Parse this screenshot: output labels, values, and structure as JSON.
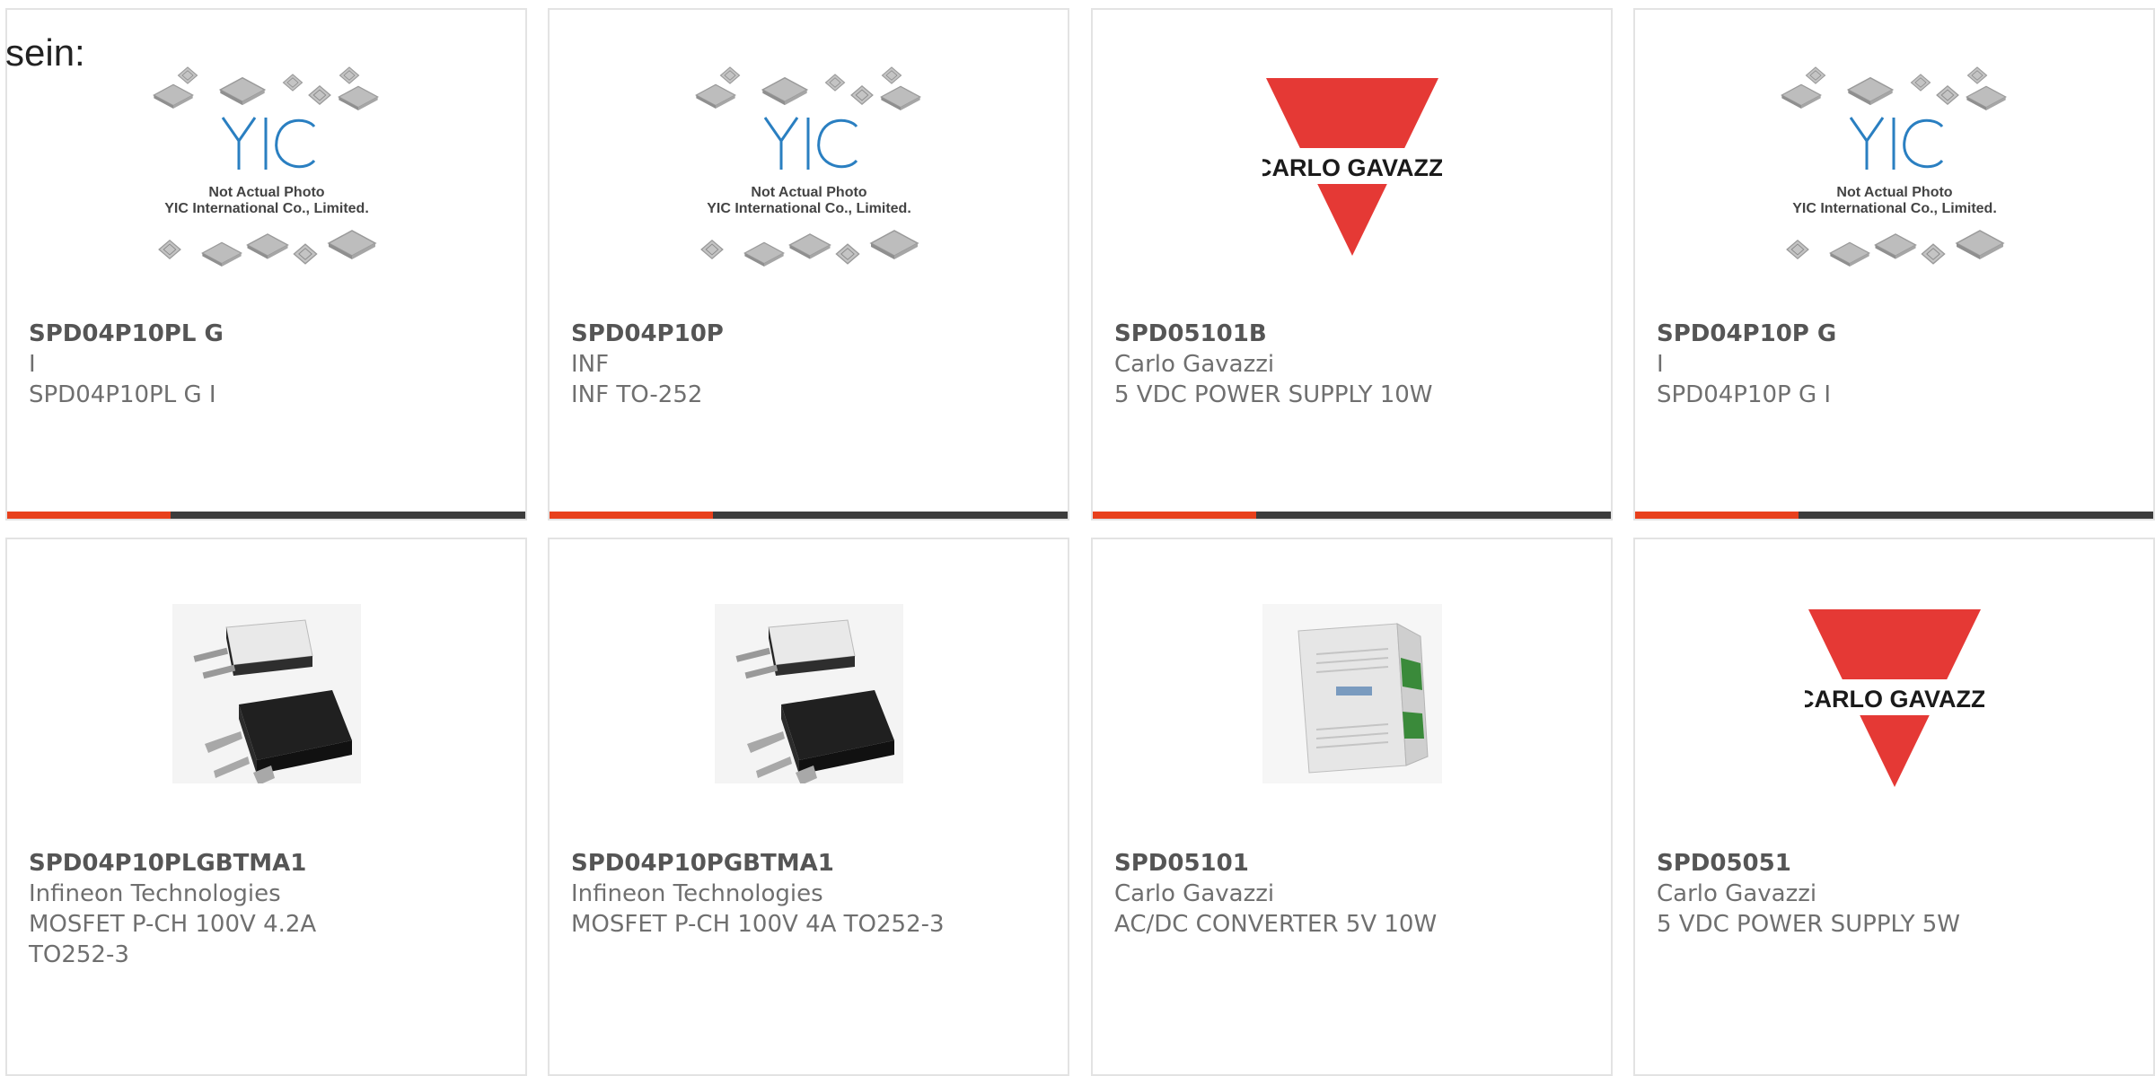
{
  "intro": "sein:",
  "colors": {
    "accent": "#e8401c",
    "bar": "#3c3c3c",
    "border": "#e3e3e3",
    "gavazzi_red": "#e53935",
    "yic_blue": "#2a7fc1"
  },
  "products": [
    {
      "name": "SPD04P10PL G",
      "maker": "I",
      "desc": "SPD04P10PL G I",
      "image": "yic-placeholder",
      "logo": {
        "brand": "YIC",
        "line1": "Not Actual Photo",
        "line2": "YIC International Co., Limited."
      }
    },
    {
      "name": "SPD04P10P",
      "maker": "INF",
      "desc": "INF TO-252",
      "image": "yic-placeholder",
      "logo": {
        "brand": "YIC",
        "line1": "Not Actual Photo",
        "line2": "YIC International Co., Limited."
      }
    },
    {
      "name": "SPD05101B",
      "maker": "Carlo Gavazzi",
      "desc": "5 VDC POWER SUPPLY 10W",
      "image": "carlo-gavazzi-logo",
      "logo": {
        "brand": "CARLO GAVAZZI"
      }
    },
    {
      "name": "SPD04P10P G",
      "maker": "I",
      "desc": "SPD04P10P G I",
      "image": "yic-placeholder",
      "logo": {
        "brand": "YIC",
        "line1": "Not Actual Photo",
        "line2": "YIC International Co., Limited."
      }
    },
    {
      "name": "SPD04P10PLGBTMA1",
      "maker": "Infineon Technologies",
      "desc": "MOSFET P-CH 100V 4.2A TO252-3",
      "image": "to252-package"
    },
    {
      "name": "SPD04P10PGBTMA1",
      "maker": "Infineon Technologies",
      "desc": "MOSFET P-CH 100V 4A TO252-3",
      "image": "to252-package"
    },
    {
      "name": "SPD05101",
      "maker": "Carlo Gavazzi",
      "desc": "AC/DC CONVERTER 5V 10W",
      "image": "din-rail-power-supply"
    },
    {
      "name": "SPD05051",
      "maker": "Carlo Gavazzi",
      "desc": "5 VDC POWER SUPPLY 5W",
      "image": "carlo-gavazzi-logo",
      "logo": {
        "brand": "CARLO GAVAZZI"
      }
    }
  ]
}
